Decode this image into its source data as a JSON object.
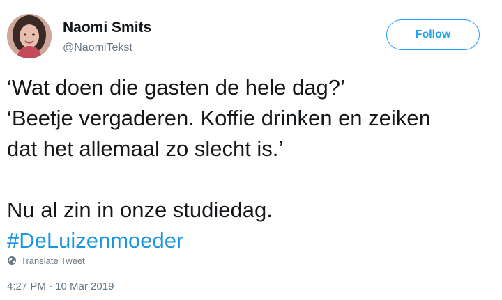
{
  "user": {
    "display_name": "Naomi Smits",
    "handle": "@NaomiTekst",
    "avatar_icon": "profile-photo"
  },
  "follow_button": {
    "label": "Follow",
    "color": "#1da1f2"
  },
  "tweet": {
    "lines": [
      "‘Wat doen die gasten de hele dag?’",
      "‘Beetje vergaderen. Koffie drinken en zeiken",
      "dat het allemaal zo slecht is.’",
      "Nu al zin in onze studiedag."
    ],
    "hashtag": "#DeLuizenmoeder",
    "hashtag_color": "#1b95e0"
  },
  "translate": {
    "label": "Translate Tweet",
    "icon": "globe-icon"
  },
  "timestamp": "4:27 PM - 10 Mar 2019"
}
